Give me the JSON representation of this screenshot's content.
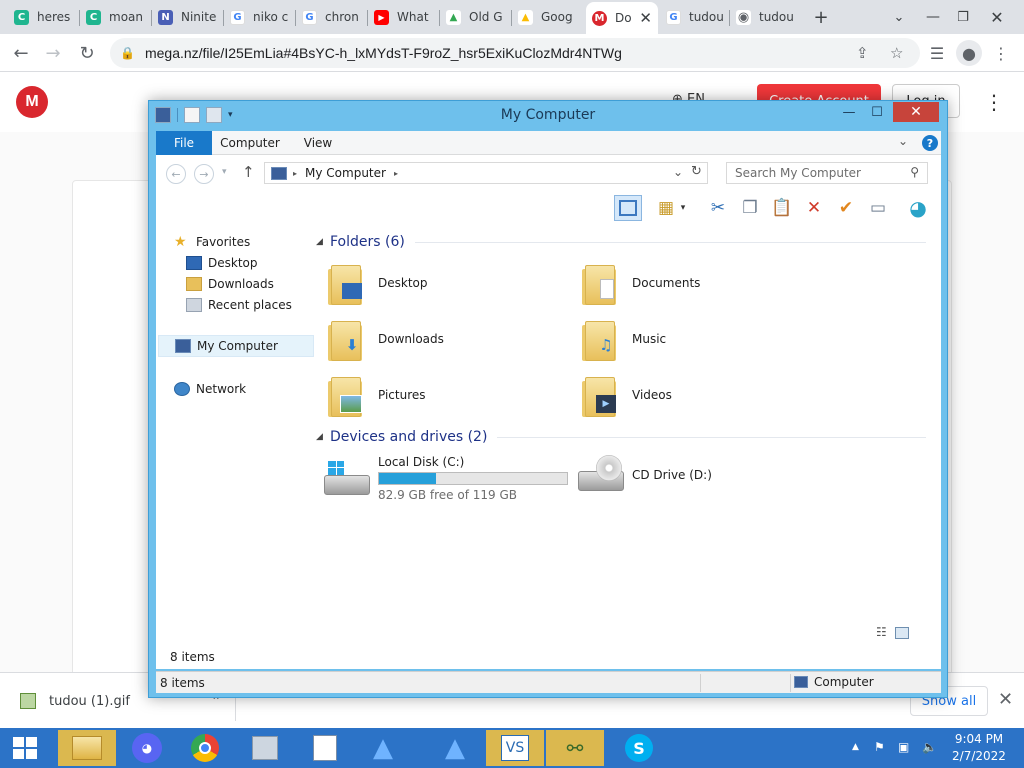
{
  "browser": {
    "tabs": [
      {
        "label": "heres",
        "fav_color": "#1fb58f",
        "fav_glyph": "C"
      },
      {
        "label": "moan",
        "fav_color": "#1fb58f",
        "fav_glyph": "C"
      },
      {
        "label": "Ninite",
        "fav_color": "#4a5fb6",
        "fav_glyph": "N"
      },
      {
        "label": "niko c",
        "fav_color": "#ffffff",
        "fav_glyph": "G"
      },
      {
        "label": "chron",
        "fav_color": "#ffffff",
        "fav_glyph": "G"
      },
      {
        "label": "What",
        "fav_color": "#ff0000",
        "fav_glyph": "▶"
      },
      {
        "label": "Old G",
        "fav_color": "#ffffff",
        "fav_glyph": "▲"
      },
      {
        "label": "Goog",
        "fav_color": "#ffffff",
        "fav_glyph": "▲"
      },
      {
        "label": "Do",
        "fav_color": "#d9272e",
        "fav_glyph": "M",
        "active": true
      },
      {
        "label": "tudou",
        "fav_color": "#ffffff",
        "fav_glyph": "G"
      },
      {
        "label": "tudou",
        "fav_color": "#5f6368",
        "fav_glyph": "◉"
      }
    ],
    "new_tab": "+",
    "url": "mega.nz/file/I25EmLia#4BsYC-h_lxMYdsT-F9roZ_hsr5ExiKuClozMdr4NTWg"
  },
  "mega": {
    "logo": "M",
    "lang": "EN",
    "create_account": "Create Account",
    "login": "Log in"
  },
  "download_bar": {
    "file": "tudou (1).gif",
    "show_all": "Show all"
  },
  "explorer": {
    "title": "My Computer",
    "ribbon_tabs": [
      "File",
      "Computer",
      "View"
    ],
    "address": "My Computer",
    "search_placeholder": "Search My Computer",
    "nav": {
      "favorites": "Favorites",
      "desktop": "Desktop",
      "downloads": "Downloads",
      "recent": "Recent places",
      "my_computer": "My Computer",
      "network": "Network"
    },
    "groups": {
      "folders": "Folders (6)",
      "devices": "Devices and drives (2)"
    },
    "folders": [
      "Desktop",
      "Documents",
      "Downloads",
      "Music",
      "Pictures",
      "Videos"
    ],
    "drives": [
      {
        "name": "Local Disk (C:)",
        "free": "82.9 GB free of 119 GB",
        "used_fraction": 0.303
      },
      {
        "name": "CD Drive (D:)"
      }
    ],
    "items_count": "8 items",
    "status_items": "8 items",
    "status_location": "Computer"
  },
  "taskbar": {
    "time": "9:04 PM",
    "date": "2/7/2022"
  },
  "colors": {
    "explorer_border": "#6ec0ec",
    "taskbar": "#2c73c7",
    "mega_red": "#d9272e",
    "file_tab": "#1979ca"
  }
}
